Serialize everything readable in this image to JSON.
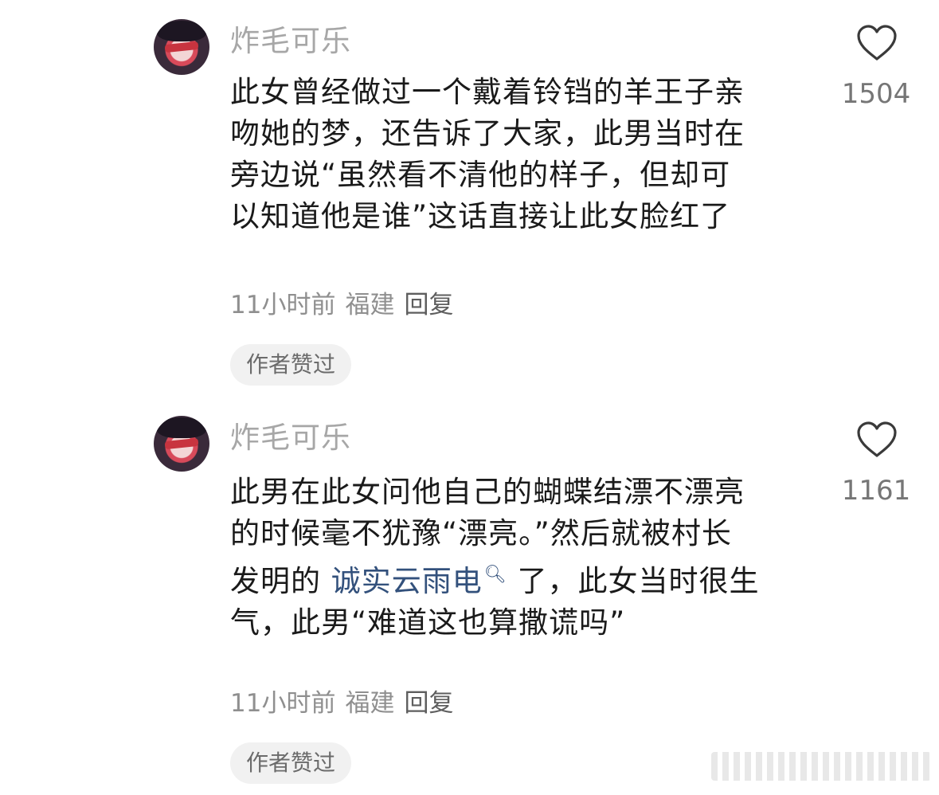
{
  "comments": [
    {
      "username": "炸毛可乐",
      "lines": [
        "此女曾经做过一个戴着铃铛的羊王子亲",
        "吻她的梦，还告诉了大家，此男当时在",
        "旁边说“虽然看不清他的样子，但却可",
        "以知道他是谁”这话直接让此女脸红了"
      ],
      "time": "11小时前",
      "location": "福建",
      "reply_label": "回复",
      "author_badge": "作者赞过",
      "likes": "1504"
    },
    {
      "username": "炸毛可乐",
      "line1": "此男在此女问他自己的蝴蝶结漂不漂亮",
      "line2": "的时候毫不犹豫“漂亮。”然后就被村长",
      "line3_prefix": "发明的 ",
      "line3_topic": "诚实云雨电",
      "line3_suffix": " 了，此女当时很生",
      "line4": "气，此男“难道这也算撒谎吗”",
      "time": "11小时前",
      "location": "福建",
      "reply_label": "回复",
      "author_badge": "作者赞过",
      "likes": "1161"
    }
  ],
  "icons": {
    "like": "heart-outline-icon",
    "topic_search": "search-icon"
  },
  "colors": {
    "username": "#a7a7a7",
    "text": "#1a1a1a",
    "topic_link": "#33517c",
    "meta": "#8f8f8f",
    "badge_bg": "#f1f1f1"
  }
}
